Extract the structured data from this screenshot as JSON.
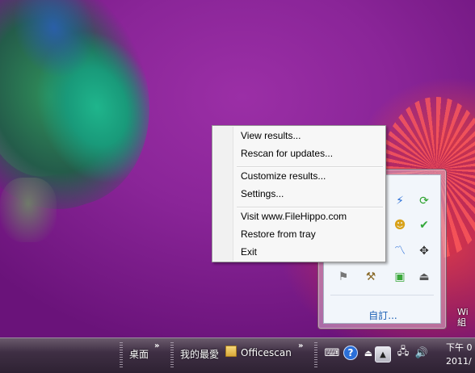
{
  "context_menu": {
    "items": [
      "View results...",
      "Rescan for updates...",
      "Customize results...",
      "Settings...",
      "Visit www.FileHippo.com",
      "Restore from tray",
      "Exit"
    ]
  },
  "tray_panel": {
    "customize_link": "自訂...",
    "icons": [
      {
        "name": "lightning-icon",
        "glyph": "⚡",
        "color": "#2a6fd8"
      },
      {
        "name": "refresh-green-icon",
        "glyph": "⟳",
        "color": "#2aa12a"
      },
      {
        "name": "people-icon",
        "glyph": "☻",
        "color": "#d8a21a"
      },
      {
        "name": "messenger-icon",
        "glyph": "✔",
        "color": "#33a83a"
      },
      {
        "name": "network-graph-icon",
        "glyph": "〽",
        "color": "#2a6fd8"
      },
      {
        "name": "move-cross-icon",
        "glyph": "✥",
        "color": "#333333"
      },
      {
        "name": "flag-icon",
        "glyph": "⚑",
        "color": "#777777"
      },
      {
        "name": "wand-icon",
        "glyph": "⚒",
        "color": "#8a6a2a"
      },
      {
        "name": "clipboard-icon",
        "glyph": "▣",
        "color": "#3aa83a"
      },
      {
        "name": "usb-safe-remove-icon",
        "glyph": "⏏",
        "color": "#555555"
      }
    ]
  },
  "taskbar": {
    "desktop_toolbar": "桌面",
    "favorites_toolbar": "我的最愛",
    "officescan_label": "Officescan",
    "chevron": "»",
    "clock_line1": "下午 0",
    "clock_line2": "2011/"
  },
  "desktop": {
    "watermark_line1": "Wi",
    "watermark_line2": "組"
  }
}
